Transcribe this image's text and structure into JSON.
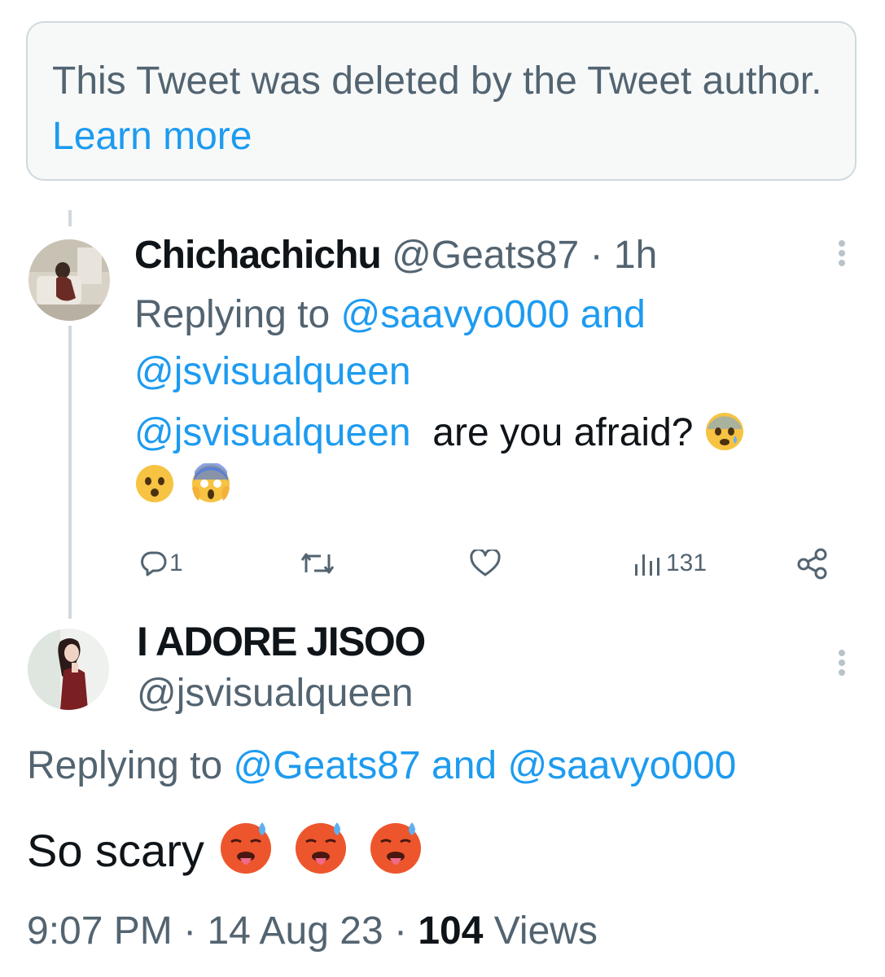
{
  "deleted_notice": {
    "text": "This Tweet was deleted by the Tweet author.",
    "link": "Learn more"
  },
  "reply_tweet": {
    "name": "Chichachichu",
    "handle": "@Geats87",
    "separator": "·",
    "time": "1h",
    "replying_label": "Replying to",
    "replying_user1": "@saavyo000",
    "replying_and": "and",
    "replying_user2": "@jsvisualqueen",
    "mention": "@jsvisualqueen",
    "text": "are you afraid?",
    "emojis": [
      "anxious-face-with-sweat",
      "hushed-face",
      "face-screaming-in-fear"
    ],
    "replies": "1",
    "retweets": "",
    "likes": "",
    "views": "131"
  },
  "main_tweet": {
    "name": "I ADORE JISOO",
    "handle": "@jsvisualqueen",
    "replying_label": "Replying to",
    "replying_user1": "@Geats87",
    "replying_and": "and",
    "replying_user2": "@saavyo000",
    "text": "So scary",
    "emojis": [
      "hot-face",
      "hot-face",
      "hot-face"
    ],
    "time": "9:07 PM",
    "sep": "·",
    "date": "14 Aug 23",
    "views_count": "104",
    "views_label": "Views"
  },
  "colors": {
    "accent": "#1d9bf0",
    "muted": "#536471",
    "text": "#0f1419",
    "border": "#cfd9de"
  }
}
